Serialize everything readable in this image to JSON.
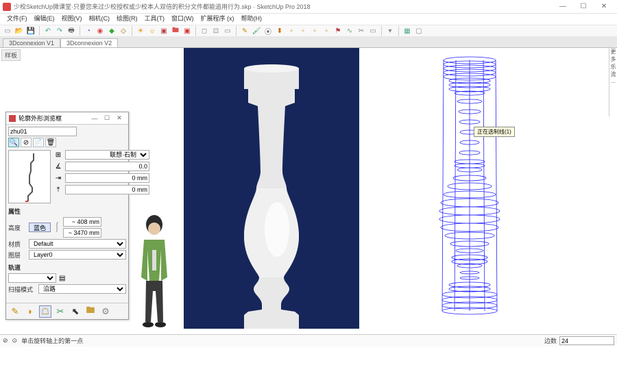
{
  "app": {
    "title": "少校SketchUp微课堂·只要您来过少校授权或少校本人双倍的积分文件都能追用行为.skp · SketchUp Pro 2018",
    "win": {
      "min": "—",
      "max": "☐",
      "close": "✕"
    }
  },
  "menu": [
    "文件(F)",
    "编辑(E)",
    "视图(V)",
    "相机(C)",
    "绘图(R)",
    "工具(T)",
    "窗口(W)",
    "扩展程序 (x)",
    "帮助(H)"
  ],
  "tabs": {
    "a": "3Dconnexion V1",
    "b": "3Dconnexion V2"
  },
  "scene": {
    "tooltip": "正在选制线(1)"
  },
  "panel": {
    "title": "轮廓外形浏览框",
    "name_value": "zhu01",
    "grid_icon": "⊞",
    "team_select": "联想·石制",
    "rotation": "0.0",
    "offset1": "0 mm",
    "offset2": "0 mm",
    "section_props": "属性",
    "height_label": "高度",
    "btn_blue": "蓝色",
    "val_top": "~ 408 mm",
    "val_bottom": "~ 3470 mm",
    "material_label": "材质",
    "material_value": "Default",
    "layer_label": "图层",
    "layer_value": "Layer0",
    "section_path": "轨道",
    "mode_label": "扫描模式",
    "mode_value": "沿路"
  },
  "status": {
    "help1": "⊘",
    "help2": "⊙",
    "hint": "单击旋转轴上的第一点",
    "meas_label": "边数",
    "meas_value": "24"
  },
  "side": {
    "left": "样板",
    "right": "更多\n乐\n流\n..."
  }
}
